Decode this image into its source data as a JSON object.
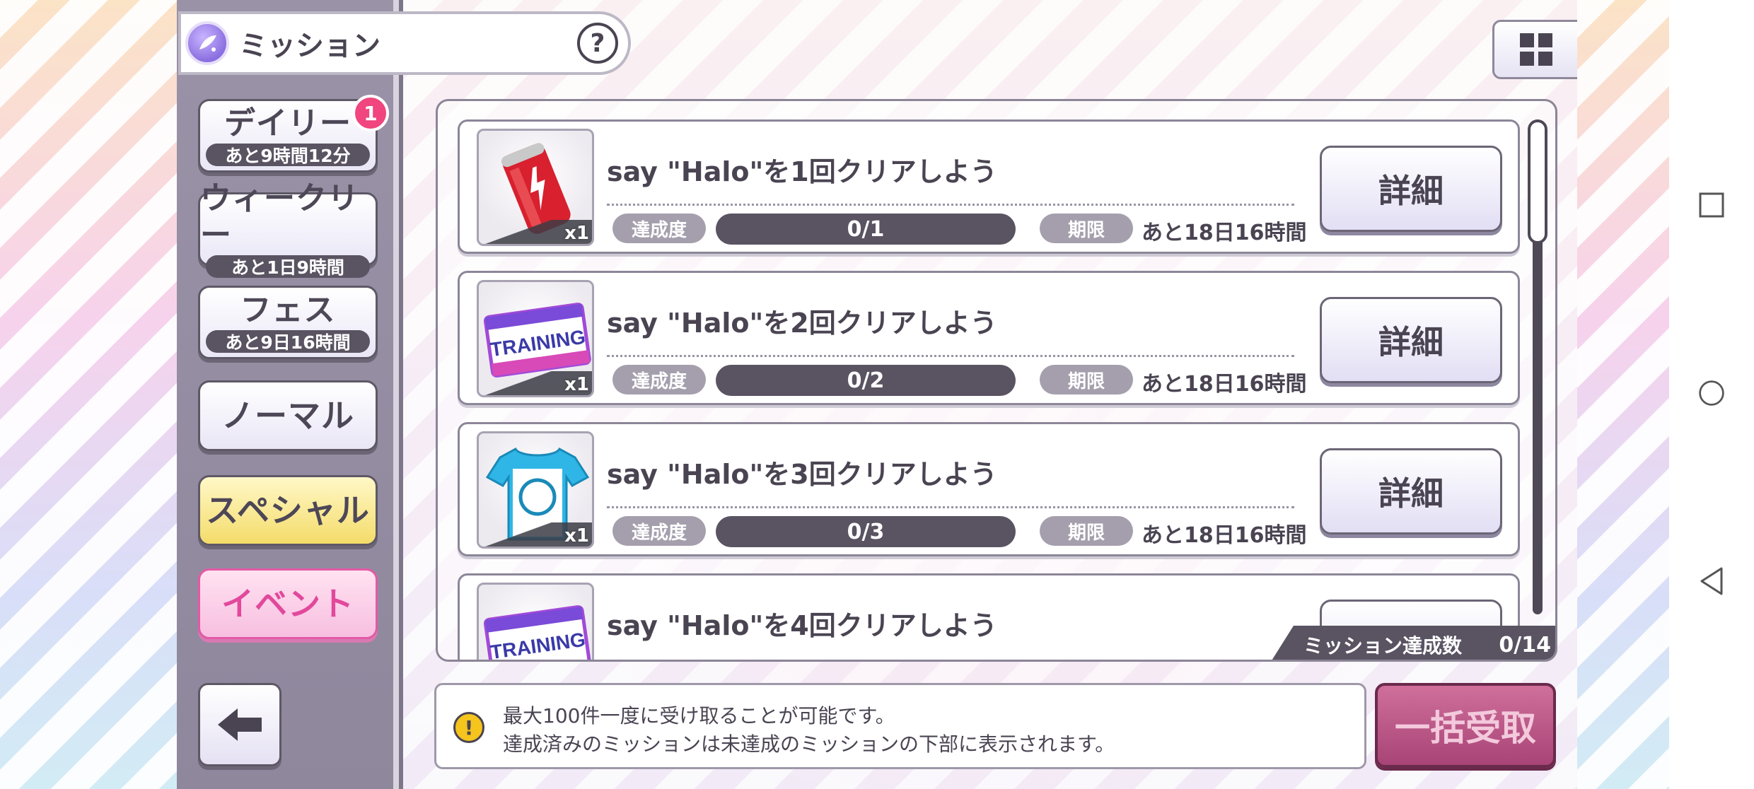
{
  "header": {
    "title": "ミッション",
    "help_label": "?"
  },
  "sidebar": {
    "tabs": [
      {
        "label": "デイリー",
        "sub": "あと9時間12分",
        "badge": "1"
      },
      {
        "label": "ウィークリー",
        "sub": "あと1日9時間"
      },
      {
        "label": "フェス",
        "sub": "あと9日16時間"
      },
      {
        "label": "ノーマル"
      },
      {
        "label": "スペシャル"
      },
      {
        "label": "イベント"
      }
    ]
  },
  "missions": [
    {
      "title": "say \"Halo\"を1回クリアしよう",
      "item": "energy-drink-can",
      "qty": "x1",
      "progress_label": "達成度",
      "progress_text": "0/1",
      "progress_fraction": 0,
      "limit_label": "期限",
      "limit_text": "あと18日16時間",
      "button": "詳細"
    },
    {
      "title": "say \"Halo\"を2回クリアしよう",
      "item": "training-ticket",
      "qty": "x1",
      "progress_label": "達成度",
      "progress_text": "0/2",
      "progress_fraction": 0,
      "limit_label": "期限",
      "limit_text": "あと18日16時間",
      "button": "詳細"
    },
    {
      "title": "say \"Halo\"を3回クリアしよう",
      "item": "tshirt",
      "qty": "x1",
      "progress_label": "達成度",
      "progress_text": "0/3",
      "progress_fraction": 0,
      "limit_label": "期限",
      "limit_text": "あと18日16時間",
      "button": "詳細"
    },
    {
      "title": "say \"Halo\"を4回クリアしよう",
      "item": "training-ticket",
      "qty": "",
      "progress_label": "",
      "progress_text": "",
      "progress_fraction": 0,
      "limit_label": "",
      "limit_text": "",
      "button": ""
    }
  ],
  "summary": {
    "label": "ミッション達成数",
    "value": "0/14"
  },
  "info": {
    "line1": "最大100件一度に受け取ることが可能です。",
    "line2": "達成済みのミッションは未達成のミッションの下部に表示されます。"
  },
  "receive_all_label": "一括受取",
  "colors": {
    "accent_pink": "#e44b8d",
    "dark_bar": "#5a5362",
    "text": "#4a4452"
  }
}
